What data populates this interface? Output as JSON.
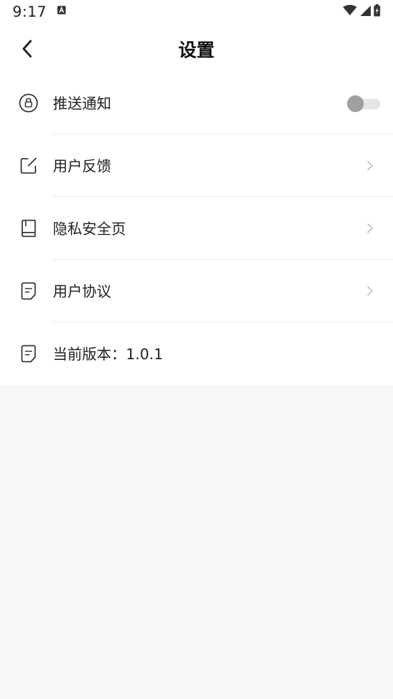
{
  "status_bar": {
    "time": "9:17",
    "notification_icon": "a-notification-icon",
    "wifi_icon": "wifi-icon",
    "signal_icon": "signal-icon",
    "battery_icon": "battery-charging-icon"
  },
  "header": {
    "back_icon": "chevron-left-icon",
    "title": "设置"
  },
  "settings": {
    "push": {
      "label": "推送通知",
      "icon": "lock-circle-icon",
      "toggle_on": false
    },
    "feedback": {
      "label": "用户反馈",
      "icon": "edit-icon",
      "chevron": "chevron-right-icon"
    },
    "privacy": {
      "label": "隐私安全页",
      "icon": "book-icon",
      "chevron": "chevron-right-icon"
    },
    "agreement": {
      "label": "用户协议",
      "icon": "document-icon",
      "chevron": "chevron-right-icon"
    },
    "version": {
      "label": "当前版本：1.0.1",
      "icon": "document-icon"
    }
  },
  "colors": {
    "background": "#f7f8fa",
    "card": "#ffffff",
    "text": "#222222",
    "chevron": "#c0c0c0",
    "toggle_knob": "#a0a0a0",
    "toggle_track": "#e6e6e6"
  }
}
